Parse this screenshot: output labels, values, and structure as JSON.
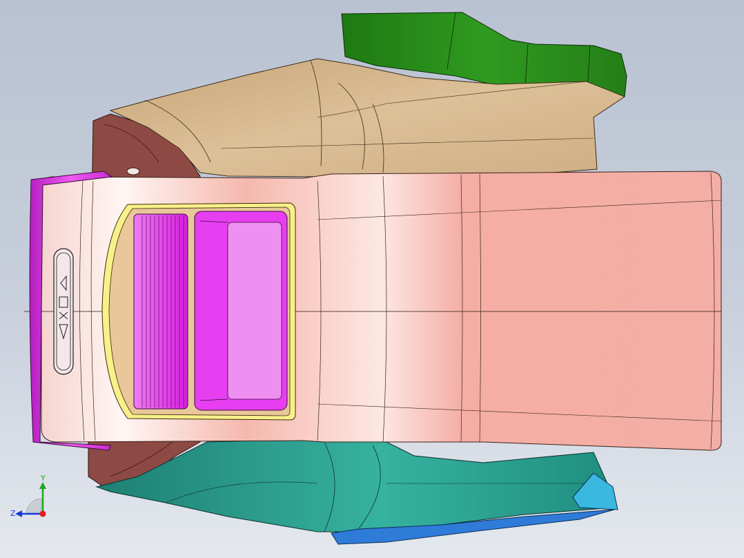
{
  "triad": {
    "y_label": "Y",
    "z_label": "Z",
    "colors": {
      "y": "#1ea51e",
      "z": "#1a3ad6",
      "x": "#e01f1f"
    }
  },
  "part_colors": {
    "lid": "#f5aea3",
    "base_tan": "#d8b98e",
    "green_panel": "#2a8a1a",
    "teal_panel": "#2a9f8f",
    "magenta_trim": "#d53ad6",
    "storage_magenta": "#e63ef0",
    "maroon": "#8d4a45",
    "blue_bracket": "#2f7bd8",
    "emblem": "#f3e7ea"
  },
  "emblem": {
    "icon": "brand-emblem-icon"
  }
}
